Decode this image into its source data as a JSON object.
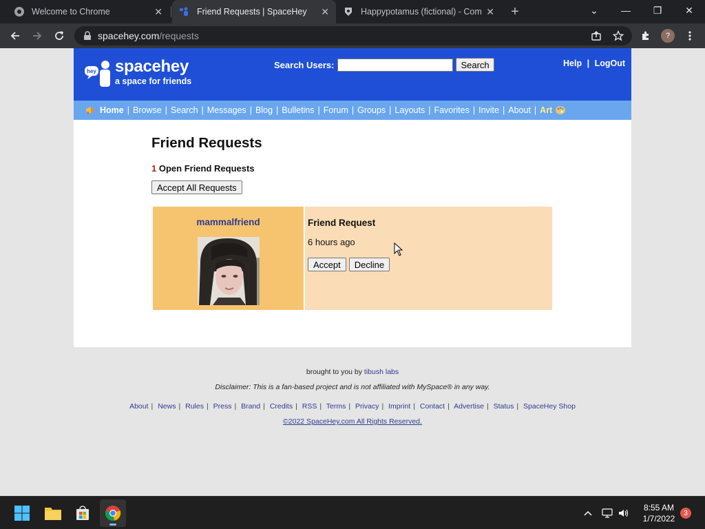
{
  "browser": {
    "tabs": [
      {
        "title": "Welcome to Chrome",
        "icon": "chrome-icon"
      },
      {
        "title": "Friend Requests | SpaceHey",
        "icon": "spacehey-icon",
        "active": true
      },
      {
        "title": "Happypotamus (fictional) - Comp",
        "icon": "fandom-icon"
      }
    ],
    "url_host": "spacehey.com",
    "url_path": "/requests"
  },
  "site": {
    "logo_name": "spacehey",
    "logo_tagline": "a space for friends",
    "logo_bubble": "hey",
    "search_label": "Search Users:",
    "search_button": "Search",
    "search_value": "",
    "help": "Help",
    "sep": "|",
    "logout": "LogOut",
    "nav": [
      "Home",
      "Browse",
      "Search",
      "Messages",
      "Blog",
      "Bulletins",
      "Forum",
      "Groups",
      "Layouts",
      "Favorites",
      "Invite",
      "About",
      "Art"
    ],
    "colors": {
      "header": "#1e4fd6",
      "nav": "#6aa6ee",
      "req_left": "#f6c46f",
      "req_right": "#fadcb6",
      "link": "#2e3b8f"
    }
  },
  "page": {
    "title": "Friend Requests",
    "open_count": "1",
    "open_label": "Open Friend Requests",
    "accept_all": "Accept All Requests",
    "request": {
      "username": "mammalfriend",
      "heading": "Friend Request",
      "time": "6 hours ago",
      "accept": "Accept",
      "decline": "Decline"
    }
  },
  "footer": {
    "brought_prefix": "brought to you by",
    "brought_link": "tibush labs",
    "disclaimer": "Disclaimer: This is a fan-based project and is not affiliated with MySpace® in any way.",
    "links": [
      "About",
      "News",
      "Rules",
      "Press",
      "Brand",
      "Credits",
      "RSS",
      "Terms",
      "Privacy",
      "Imprint",
      "Contact",
      "Advertise",
      "Status",
      "SpaceHey Shop"
    ],
    "copyright": "©2022 SpaceHey.com All Rights Reserved."
  },
  "taskbar": {
    "time": "8:55 AM",
    "date": "1/7/2022",
    "notification_count": "3"
  }
}
